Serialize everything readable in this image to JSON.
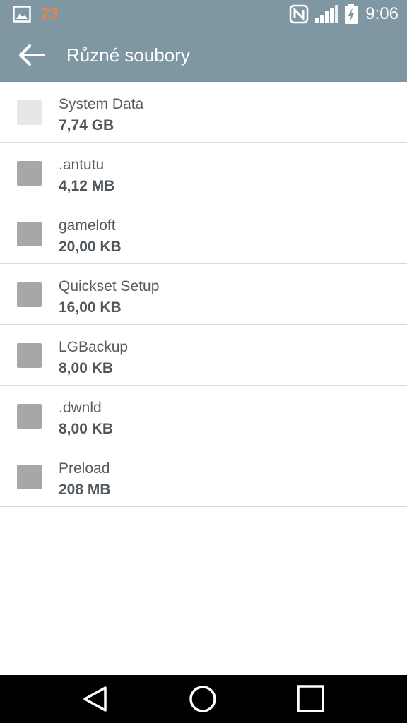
{
  "status_bar": {
    "notification_count": "23",
    "time": "9:06",
    "icons": [
      "gallery-icon",
      "nfc-icon",
      "signal-icon",
      "battery-charging-icon"
    ]
  },
  "header": {
    "title": "Různé soubory",
    "back_icon": "arrow-left-icon",
    "color": "#7e97a2"
  },
  "files": [
    {
      "name": "System Data",
      "size": "7,74 GB",
      "checkbox_enabled": false
    },
    {
      "name": ".antutu",
      "size": "4,12 MB",
      "checkbox_enabled": true
    },
    {
      "name": "gameloft",
      "size": "20,00 KB",
      "checkbox_enabled": true
    },
    {
      "name": "Quickset Setup",
      "size": "16,00 KB",
      "checkbox_enabled": true
    },
    {
      "name": "LGBackup",
      "size": "8,00 KB",
      "checkbox_enabled": true
    },
    {
      "name": ".dwnld",
      "size": "8,00 KB",
      "checkbox_enabled": true
    },
    {
      "name": "Preload",
      "size": "208 MB",
      "checkbox_enabled": true
    }
  ],
  "nav_bar": {
    "buttons": [
      "back-triangle-icon",
      "home-circle-icon",
      "recents-square-icon"
    ]
  }
}
